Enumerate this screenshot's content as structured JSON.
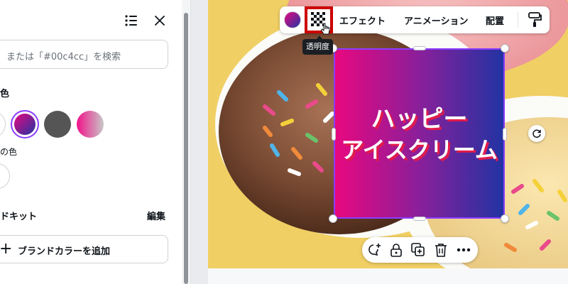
{
  "panel": {
    "search_placeholder": "または「#00c4cc」を検索",
    "color_section_title": "色",
    "recent_colors_caption": "の色",
    "brand_kit_title": "ドキット",
    "edit_link": "編集",
    "add_brand_color": "ブランドカラーを追加",
    "swatches": [
      {
        "name": "white",
        "fill": "#ffffff"
      },
      {
        "name": "selected-gradient",
        "fill": "linear-gradient(135deg,#e8087f,#2233a3)"
      },
      {
        "name": "dark-gray",
        "fill": "#555555"
      },
      {
        "name": "pink-gradient",
        "fill": "linear-gradient(90deg,#f0138a,#c8c8c8)"
      }
    ]
  },
  "toolbar": {
    "effect": "エフェクト",
    "animation": "アニメーション",
    "position": "配置",
    "tooltip": "透明度",
    "accent_highlight": "#cc0000"
  },
  "design": {
    "line1": "ハッピー",
    "line2": "アイスクリーム",
    "gradient_start": "#e8087f",
    "gradient_end": "#2233a3",
    "shadow_color": "#e21b4b"
  },
  "colors": {
    "selection": "#8b3dff"
  }
}
